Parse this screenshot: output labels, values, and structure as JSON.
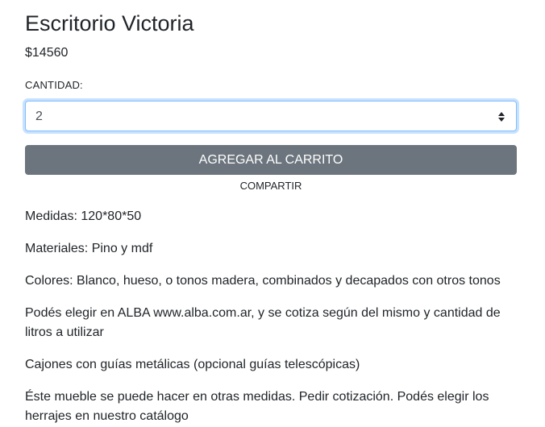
{
  "product": {
    "title": "Escritorio Victoria",
    "price": "$14560"
  },
  "quantity": {
    "label": "CANTIDAD:",
    "value": "2"
  },
  "actions": {
    "add_to_cart": "AGREGAR AL CARRITO",
    "share": "COMPARTIR"
  },
  "description": [
    "Medidas: 120*80*50",
    "Materiales: Pino y mdf",
    "Colores: Blanco, hueso, o tonos madera, combinados y decapados con otros tonos",
    "Podés elegir en ALBA www.alba.com.ar, y se cotiza según del mismo y cantidad de litros a utilizar",
    "Cajones con guías metálicas (opcional guías telescópicas)",
    "Éste mueble se puede hacer en otras medidas. Pedir cotización. Podés elegir los herrajes en nuestro catálogo"
  ],
  "colors": {
    "button": "#6c757d",
    "focus_border": "#80bdff"
  }
}
